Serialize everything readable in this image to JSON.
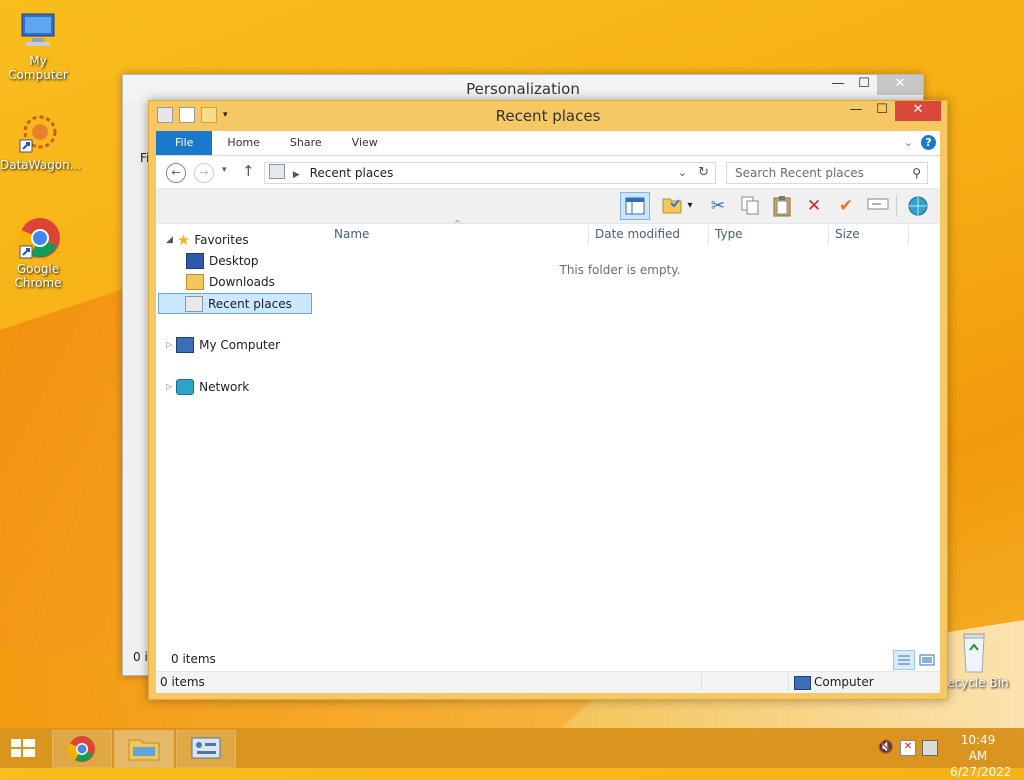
{
  "desktop": {
    "icons": [
      {
        "label": "My Computer"
      },
      {
        "label": "DataWagon..."
      },
      {
        "label": "Google Chrome"
      },
      {
        "label": "Recycle Bin"
      }
    ]
  },
  "back_window": {
    "title": "Personalization",
    "partial_text_1": "Fi",
    "partial_text_2": "0 it"
  },
  "window": {
    "title": "Recent places",
    "minimize": "—",
    "maximize": "☐",
    "close": "✕"
  },
  "ribbon": {
    "tabs": [
      "File",
      "Home",
      "Share",
      "View"
    ]
  },
  "address": {
    "path": "Recent places",
    "search_placeholder": "Search Recent places"
  },
  "nav": {
    "favorites": "Favorites",
    "desktop": "Desktop",
    "downloads": "Downloads",
    "recent_places": "Recent places",
    "my_computer": "My Computer",
    "network": "Network"
  },
  "columns": [
    "Name",
    "Date modified",
    "Type",
    "Size"
  ],
  "empty_message": "This folder is empty.",
  "status": {
    "items_inner": "0 items",
    "items": "0 items",
    "location": "Computer"
  },
  "tray": {
    "time": "10:49 AM",
    "date": "6/27/2022"
  },
  "colors": {
    "accent": "#1979ca",
    "window_frame": "#f6c863",
    "close_button": "#d9483b",
    "selection": "#cce8ff"
  }
}
